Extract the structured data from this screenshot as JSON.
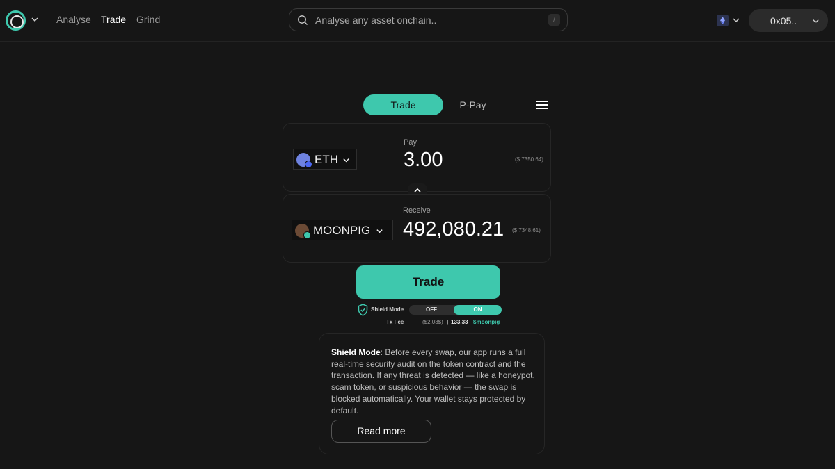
{
  "nav": {
    "items": [
      {
        "label": "Analyse",
        "active": false
      },
      {
        "label": "Trade",
        "active": true
      },
      {
        "label": "Grind",
        "active": false
      }
    ]
  },
  "search": {
    "placeholder": "Analyse any asset onchain..",
    "shortcut": "/"
  },
  "wallet": {
    "address": "0x05.."
  },
  "tabs": {
    "trade": "Trade",
    "ppay": "P-Pay"
  },
  "pay": {
    "label": "Pay",
    "token": "ETH",
    "amount": "3.00",
    "usd": "($ 7350.64)"
  },
  "receive": {
    "label": "Receive",
    "token": "MOONPIG",
    "amount": "492,080.21",
    "usd": "($ 7348.61)"
  },
  "trade_button": "Trade",
  "shield": {
    "label": "Shield Mode",
    "off": "OFF",
    "on": "ON",
    "state": "on"
  },
  "fee": {
    "label": "Tx Fee",
    "usd": "($2.03$)",
    "separator": "|",
    "amount": "133.33",
    "token": "$moonpig"
  },
  "info": {
    "title": "Shield Mode",
    "body": ": Before every swap, our app runs a full real-time security audit on the token contract and the transaction. If any threat is detected — like a honeypot, scam token, or suspicious behavior — the swap is blocked automatically. Your wallet stays protected by default.",
    "read_more": "Read more"
  },
  "colors": {
    "accent": "#3ec8ad",
    "background": "#161616",
    "panel_border": "#262626"
  }
}
